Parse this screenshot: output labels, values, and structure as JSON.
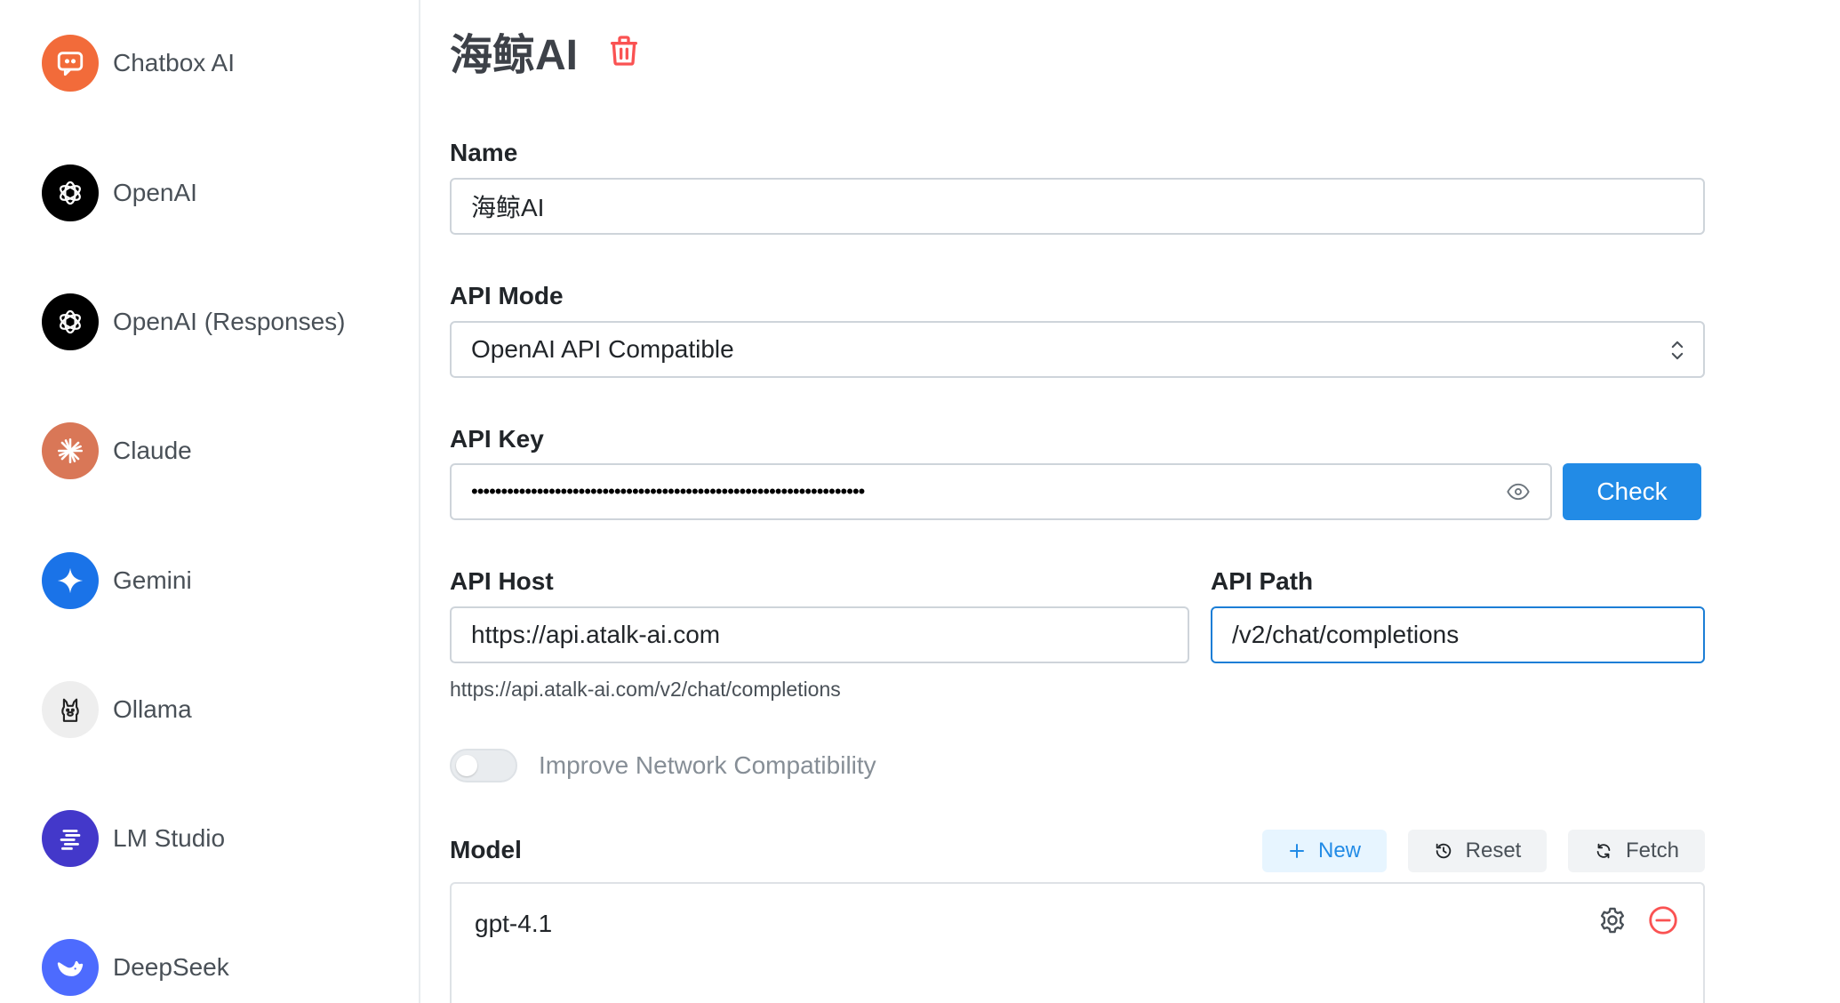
{
  "sidebar": {
    "providers": [
      {
        "label": "Chatbox AI",
        "icon": "chat-bubble-icon",
        "color": "#f26b3a"
      },
      {
        "label": "OpenAI",
        "icon": "openai-icon",
        "color": "#000000"
      },
      {
        "label": "OpenAI (Responses)",
        "icon": "openai-icon",
        "color": "#000000"
      },
      {
        "label": "Claude",
        "icon": "claude-spark-icon",
        "color": "#d97757"
      },
      {
        "label": "Gemini",
        "icon": "gemini-star-icon",
        "color": "#1a73e8"
      },
      {
        "label": "Ollama",
        "icon": "llama-icon",
        "color": "#eeeeee"
      },
      {
        "label": "LM Studio",
        "icon": "lmstudio-icon",
        "color": "#4338ca"
      },
      {
        "label": "DeepSeek",
        "icon": "whale-icon",
        "color": "#4d6bfe"
      }
    ]
  },
  "main": {
    "title": "海鲸AI",
    "name": {
      "label": "Name",
      "value": "海鲸AI"
    },
    "api_mode": {
      "label": "API Mode",
      "value": "OpenAI API Compatible"
    },
    "api_key": {
      "label": "API Key",
      "value": "••••••••••••••••••••••••••••••••••••••••••••••••••••••••••••••••••",
      "check_label": "Check"
    },
    "api_host": {
      "label": "API Host",
      "value": "https://api.atalk-ai.com"
    },
    "api_path": {
      "label": "API Path",
      "value": "/v2/chat/completions"
    },
    "full_url": "https://api.atalk-ai.com/v2/chat/completions",
    "network_toggle": {
      "label": "Improve Network Compatibility",
      "enabled": false
    },
    "model": {
      "label": "Model",
      "new_label": "New",
      "reset_label": "Reset",
      "fetch_label": "Fetch",
      "items": [
        {
          "name": "gpt-4.1"
        }
      ]
    }
  },
  "colors": {
    "accent": "#228be6",
    "danger": "#fa5252"
  }
}
